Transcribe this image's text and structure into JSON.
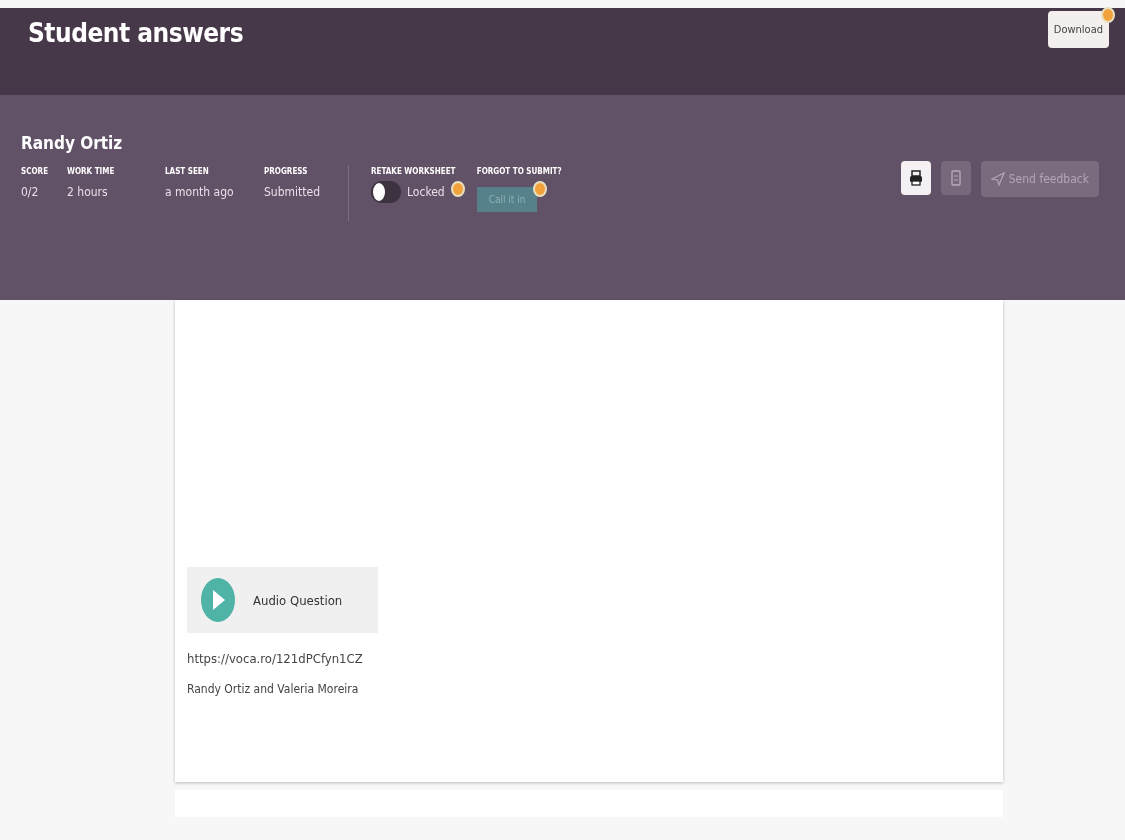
{
  "header": {
    "title": "Student answers",
    "download_button": "Download"
  },
  "student": {
    "name": "Randy Ortiz",
    "stats": [
      {
        "label": "SCORE",
        "value": "0/2"
      },
      {
        "label": "WORK TIME",
        "value": "2 hours"
      },
      {
        "label": "LAST SEEN",
        "value": "a month ago"
      },
      {
        "label": "PROGRESS",
        "value": "Submitted"
      }
    ],
    "retake": {
      "label": "RETAKE WORKSHEET",
      "toggle_label": "Locked",
      "on": false
    },
    "forgot": {
      "label": "FORGOT TO SUBMIT?",
      "button": "Call it in",
      "disabled": true
    },
    "send_feedback": {
      "label": "Send feedback",
      "disabled": true
    }
  },
  "answer": {
    "audio_label": "Audio Question",
    "link": "https://voca.ro/121dPCfyn1CZ",
    "text": "Randy Ortiz and Valeria Moreira"
  }
}
